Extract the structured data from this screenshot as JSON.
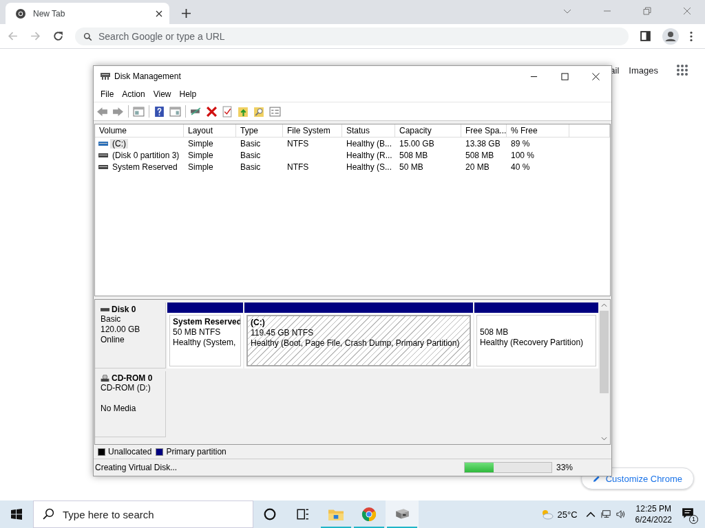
{
  "browser": {
    "tabs": [
      {
        "title": "New Tab",
        "selected": true
      }
    ],
    "address": {
      "placeholder": "Search Google or type a URL"
    },
    "page_links": [
      "ail",
      "Images"
    ],
    "customize_button": "Customize Chrome"
  },
  "window": {
    "title": "Disk Management",
    "menu": [
      "File",
      "Action",
      "View",
      "Help"
    ],
    "columns": [
      "Volume",
      "Layout",
      "Type",
      "File System",
      "Status",
      "Capacity",
      "Free Spa...",
      "% Free"
    ],
    "rows": [
      {
        "selected": true,
        "cells": [
          "(C:)",
          "Simple",
          "Basic",
          "NTFS",
          "Healthy (B...",
          "15.00 GB",
          "13.38 GB",
          "89 %"
        ]
      },
      {
        "selected": false,
        "cells": [
          "(Disk 0 partition 3)",
          "Simple",
          "Basic",
          "",
          "Healthy (R...",
          "508 MB",
          "508 MB",
          "100 %"
        ]
      },
      {
        "selected": false,
        "cells": [
          "System Reserved",
          "Simple",
          "Basic",
          "NTFS",
          "Healthy (S...",
          "50 MB",
          "20 MB",
          "40 %"
        ]
      }
    ],
    "disks": [
      {
        "kind": "disk",
        "name": "Disk 0",
        "lines": [
          "Basic",
          "120.00 GB",
          "Online"
        ],
        "partitions": [
          {
            "name": "System Reserved",
            "size": "50 MB NTFS",
            "status": "Healthy (System,",
            "selected": false
          },
          {
            "name": "(C:)",
            "size": "119.45 GB NTFS",
            "status": "Healthy (Boot, Page File, Crash Dump, Primary Partition)",
            "selected": true
          },
          {
            "size": "508 MB",
            "status": "Healthy (Recovery Partition)",
            "selected": false
          }
        ]
      },
      {
        "kind": "cdrom",
        "name": "CD-ROM 0",
        "lines": [
          "CD-ROM (D:)",
          "No Media"
        ]
      }
    ],
    "legend": [
      {
        "label": "Unallocated",
        "color": "#000000"
      },
      {
        "label": "Primary partition",
        "color": "#000080"
      }
    ],
    "status_bar": {
      "text": "Creating Virtual Disk...",
      "level": 0.33,
      "reading": "33%"
    }
  },
  "taskbar": {
    "search": {
      "placeholder": "Type here to search"
    },
    "apps": [
      {
        "kind": "explorer",
        "selected": false
      },
      {
        "kind": "chrome",
        "selected": false
      },
      {
        "kind": "diskmgmt",
        "selected": true
      }
    ],
    "temperature": "25°C",
    "time": "12:25 PM",
    "date": "6/24/2022",
    "notifications": "1"
  }
}
